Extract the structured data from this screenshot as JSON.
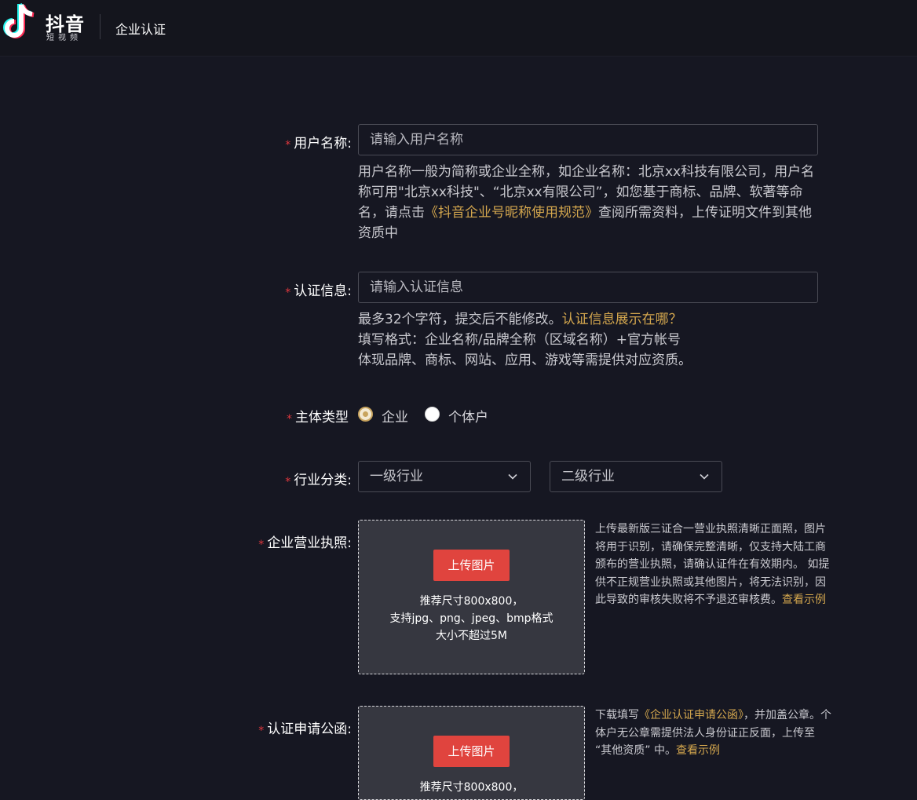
{
  "header": {
    "brand_main": "抖音",
    "brand_sub": "短视频",
    "page_title": "企业认证"
  },
  "colors": {
    "accent": "#e0443e",
    "link": "#d4a74e",
    "required": "#e0383e",
    "background": "#161722"
  },
  "form": {
    "username": {
      "label": "用户名称:",
      "placeholder": "请输入用户名称",
      "help_1": "用户名称一般为简称或企业全称，如企业名称：北京xx科技有限公司，用户名称可用\"北京xx科技\"、“北京xx有限公司”，如您基于商标、品牌、软著等命名，请点击",
      "help_link": "《抖音企业号昵称使用规范》",
      "help_2": "查阅所需资料，上传证明文件到其他资质中"
    },
    "cert_info": {
      "label": "认证信息:",
      "placeholder": "请输入认证信息",
      "help_line1_a": "最多32个字符，提交后不能修改。",
      "help_link": "认证信息展示在哪？",
      "help_line2": "填写格式：企业名称/品牌全称（区域名称）+官方帐号",
      "help_line3": "体现品牌、商标、网站、应用、游戏等需提供对应资质。"
    },
    "subject_type": {
      "label": "主体类型",
      "options": [
        "企业",
        "个体户"
      ],
      "selected": "企业"
    },
    "industry": {
      "label": "行业分类:",
      "level1_placeholder": "一级行业",
      "level2_placeholder": "二级行业"
    },
    "business_license": {
      "label": "企业营业执照:",
      "upload_button": "上传图片",
      "hint_1": "推荐尺寸800x800，",
      "hint_2": "支持jpg、png、jpeg、bmp格式",
      "hint_3": "大小不超过5M",
      "side_help": "上传最新版三证合一营业执照清晰正面照，图片将用于识别，请确保完整清晰，仅支持大陆工商颁布的营业执照，请确认证件在有效期内。 如提供不正规营业执照或其他图片，将无法识别，因此导致的审核失败将不予退还审核费。",
      "side_link": "查看示例"
    },
    "application_letter": {
      "label": "认证申请公函:",
      "upload_button": "上传图片",
      "hint_1": "推荐尺寸800x800，",
      "side_help_a": "下载填写",
      "side_link_doc": "《企业认证申请公函》",
      "side_help_b": "，并加盖公章。个体户无公章需提供法人身份证正反面，上传至 “其他资质” 中。",
      "side_link": "查看示例"
    }
  }
}
